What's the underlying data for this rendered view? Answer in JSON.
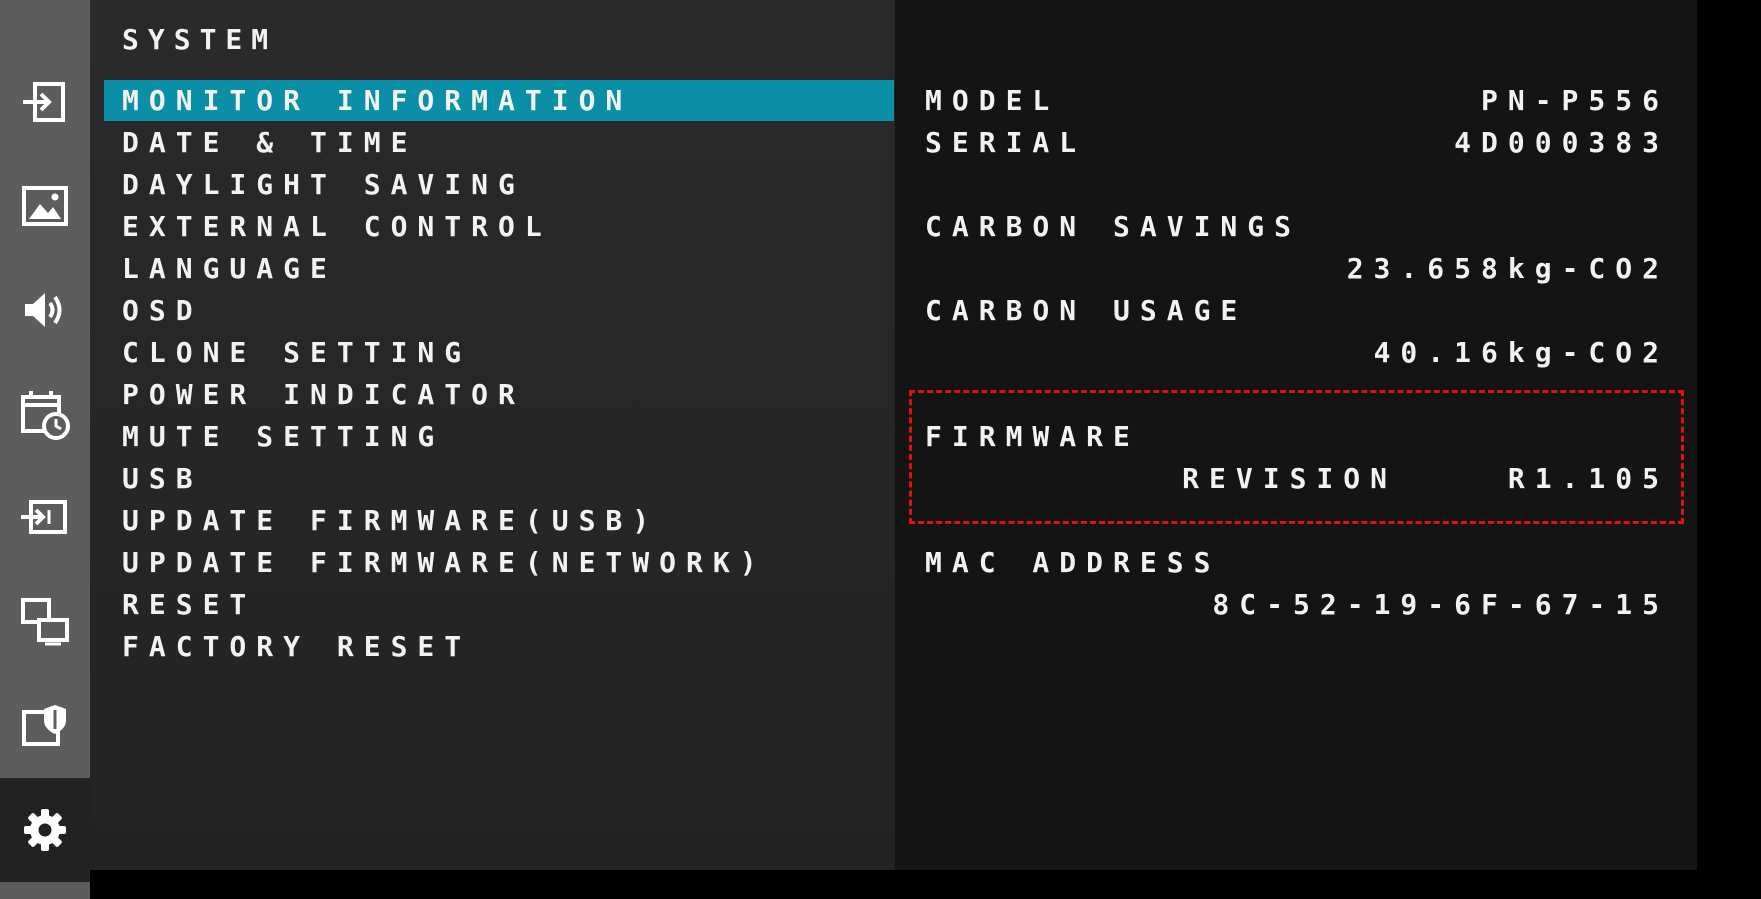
{
  "menu": {
    "title": "SYSTEM",
    "items": [
      {
        "label": "MONITOR INFORMATION",
        "selected": true
      },
      {
        "label": "DATE & TIME"
      },
      {
        "label": "DAYLIGHT SAVING"
      },
      {
        "label": "EXTERNAL CONTROL"
      },
      {
        "label": "LANGUAGE"
      },
      {
        "label": "OSD"
      },
      {
        "label": "CLONE SETTING"
      },
      {
        "label": "POWER INDICATOR"
      },
      {
        "label": "MUTE SETTING"
      },
      {
        "label": "USB"
      },
      {
        "label": "UPDATE FIRMWARE(USB)"
      },
      {
        "label": "UPDATE FIRMWARE(NETWORK)"
      },
      {
        "label": "RESET"
      },
      {
        "label": "FACTORY RESET"
      }
    ]
  },
  "sidebar": {
    "items": [
      {
        "icon": "input-icon"
      },
      {
        "icon": "picture-icon"
      },
      {
        "icon": "audio-icon"
      },
      {
        "icon": "schedule-icon"
      },
      {
        "icon": "multi-input-icon"
      },
      {
        "icon": "multi-display-icon"
      },
      {
        "icon": "protect-icon"
      },
      {
        "icon": "gear-icon",
        "active": true
      }
    ]
  },
  "info": {
    "model_label": "MODEL",
    "model_value": "PN-P556",
    "serial_label": "SERIAL",
    "serial_value": "4D000383",
    "carbon_savings_label": "CARBON SAVINGS",
    "carbon_savings_value": "23.658kg-CO2",
    "carbon_usage_label": "CARBON USAGE",
    "carbon_usage_value": "40.16kg-CO2",
    "firmware_label": "FIRMWARE",
    "revision_label": "REVISION",
    "revision_value": "R1.105",
    "mac_label": "MAC ADDRESS",
    "mac_value": "8C-52-19-6F-67-15"
  },
  "colors": {
    "selection": "#0a8fa6",
    "highlight_box": "#e01010",
    "text": "#f2f2f2"
  }
}
